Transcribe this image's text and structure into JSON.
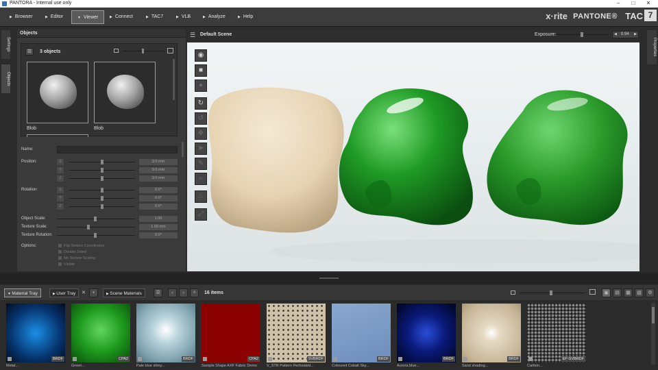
{
  "window": {
    "title": "PANTORA - Internal use only"
  },
  "menu": {
    "items": [
      {
        "label": "Browser"
      },
      {
        "label": "Editor"
      },
      {
        "label": "Viewer"
      },
      {
        "label": "Connect"
      },
      {
        "label": "TAC7"
      },
      {
        "label": "VLB"
      },
      {
        "label": "Analyze"
      },
      {
        "label": "Help"
      }
    ],
    "active": "Viewer"
  },
  "brand": {
    "xrite": "x·rite",
    "pantone": "PANTONE®",
    "tac": "TAC",
    "tac_num": "7"
  },
  "side_tabs": {
    "settings": "Settings",
    "objects": "Objects",
    "properties": "Properties"
  },
  "objects_panel": {
    "title": "Objects",
    "count": "3 objects",
    "thumbs": [
      {
        "label": "Blob"
      },
      {
        "label": "Blob"
      }
    ],
    "name_label": "Name:",
    "position_label": "Position:",
    "position_values": [
      "0.0 mm",
      "0.0 mm",
      "0.0 mm"
    ],
    "rotation_label": "Rotation:",
    "rotation_values": [
      "0.0°",
      "0.0°",
      "0.0°"
    ],
    "axes": [
      "X",
      "Y",
      "Z"
    ],
    "object_scale_label": "Object Scale:",
    "object_scale_value": "1.00",
    "texture_scale_label": "Texture Scale:",
    "texture_scale_value": "1.00 mm",
    "texture_rotation_label": "Texture Rotation:",
    "texture_rotation_value": "0.0°",
    "options_label": "Options:",
    "options": [
      "Flip Texture Coordinates",
      "Double Sided",
      "No Texture Scaling",
      "Visible"
    ]
  },
  "viewer": {
    "scene_title": "Default Scene",
    "exposure_label": "Exposure:",
    "exposure_value": "0.94",
    "tools": [
      "camera-icon",
      "square-icon",
      "sphere-icon",
      "refresh-icon",
      "rotate-icon",
      "move-icon",
      "pointer-icon",
      "pin-icon",
      "zoom-icon",
      "home-icon",
      "fit-icon"
    ]
  },
  "tray": {
    "tabs": [
      {
        "label": "Material Tray"
      },
      {
        "label": "User Tray"
      },
      {
        "label": "Scene Materials"
      }
    ],
    "items_count": "16 items",
    "materials": [
      {
        "tag": "BRDF",
        "label": "Metal...",
        "color": "#0b4fa0"
      },
      {
        "tag": "CPA2",
        "label": "Green...",
        "color": "#3aa93a"
      },
      {
        "tag": "BRDF",
        "label": "Pale blue shiny...",
        "color": "#b9d8e2"
      },
      {
        "tag": "CPA2",
        "label": "Sample Shape AXF Fabric Demo",
        "color": "#8b0000"
      },
      {
        "tag": "SVBRDF",
        "label": "V_STR Pattern Perforated...",
        "color": "#cfc2a8"
      },
      {
        "tag": "BRDF",
        "label": "Coloured Cobalt Sky...",
        "color": "#7f9ec8"
      },
      {
        "tag": "BRDF",
        "label": "Aurora blue...",
        "color": "#0d2a9e"
      },
      {
        "tag": "BRDF",
        "label": "Sand shading...",
        "color": "#d2c4aa"
      },
      {
        "tag": "EP-SVBRDF",
        "label": "Carbon...",
        "color": "#6b6b6b"
      }
    ]
  }
}
